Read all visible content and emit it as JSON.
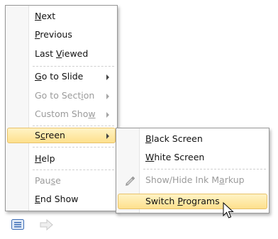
{
  "main_menu": {
    "items": [
      {
        "label": "Next",
        "mnemonic": "N",
        "enabled": true
      },
      {
        "label": "Previous",
        "mnemonic": "P",
        "enabled": true
      },
      {
        "label": "Last Viewed",
        "mnemonic": "V",
        "enabled": true
      },
      {
        "label": "Go to Slide",
        "mnemonic": "G",
        "enabled": true,
        "submenu": true
      },
      {
        "label": "Go to Section",
        "mnemonic": "i",
        "enabled": false,
        "submenu": true
      },
      {
        "label": "Custom Show",
        "mnemonic": "w",
        "enabled": false,
        "submenu": true
      },
      {
        "label": "Screen",
        "mnemonic": "c",
        "enabled": true,
        "submenu": true,
        "highlighted": true
      },
      {
        "label": "Help",
        "mnemonic": "H",
        "enabled": true
      },
      {
        "label": "Pause",
        "mnemonic": "s",
        "enabled": false
      },
      {
        "label": "End Show",
        "mnemonic": "E",
        "enabled": true
      }
    ]
  },
  "screen_submenu": {
    "items": [
      {
        "label": "Black Screen",
        "mnemonic": "B",
        "enabled": true
      },
      {
        "label": "White Screen",
        "mnemonic": "W",
        "enabled": true
      },
      {
        "label": "Show/Hide Ink Markup",
        "mnemonic": "a",
        "enabled": false,
        "icon": "ink-pen-icon"
      },
      {
        "label": "Switch Programs",
        "mnemonic": "P",
        "enabled": true,
        "highlighted": true
      }
    ]
  },
  "toolbar": {
    "icons": [
      "slide-menu-icon",
      "arrow-right-icon"
    ]
  },
  "colors": {
    "highlight_top": "#fff3c5",
    "highlight_bottom": "#fde08d",
    "highlight_border": "#e8c26a",
    "disabled_text": "#9b9b9b"
  }
}
